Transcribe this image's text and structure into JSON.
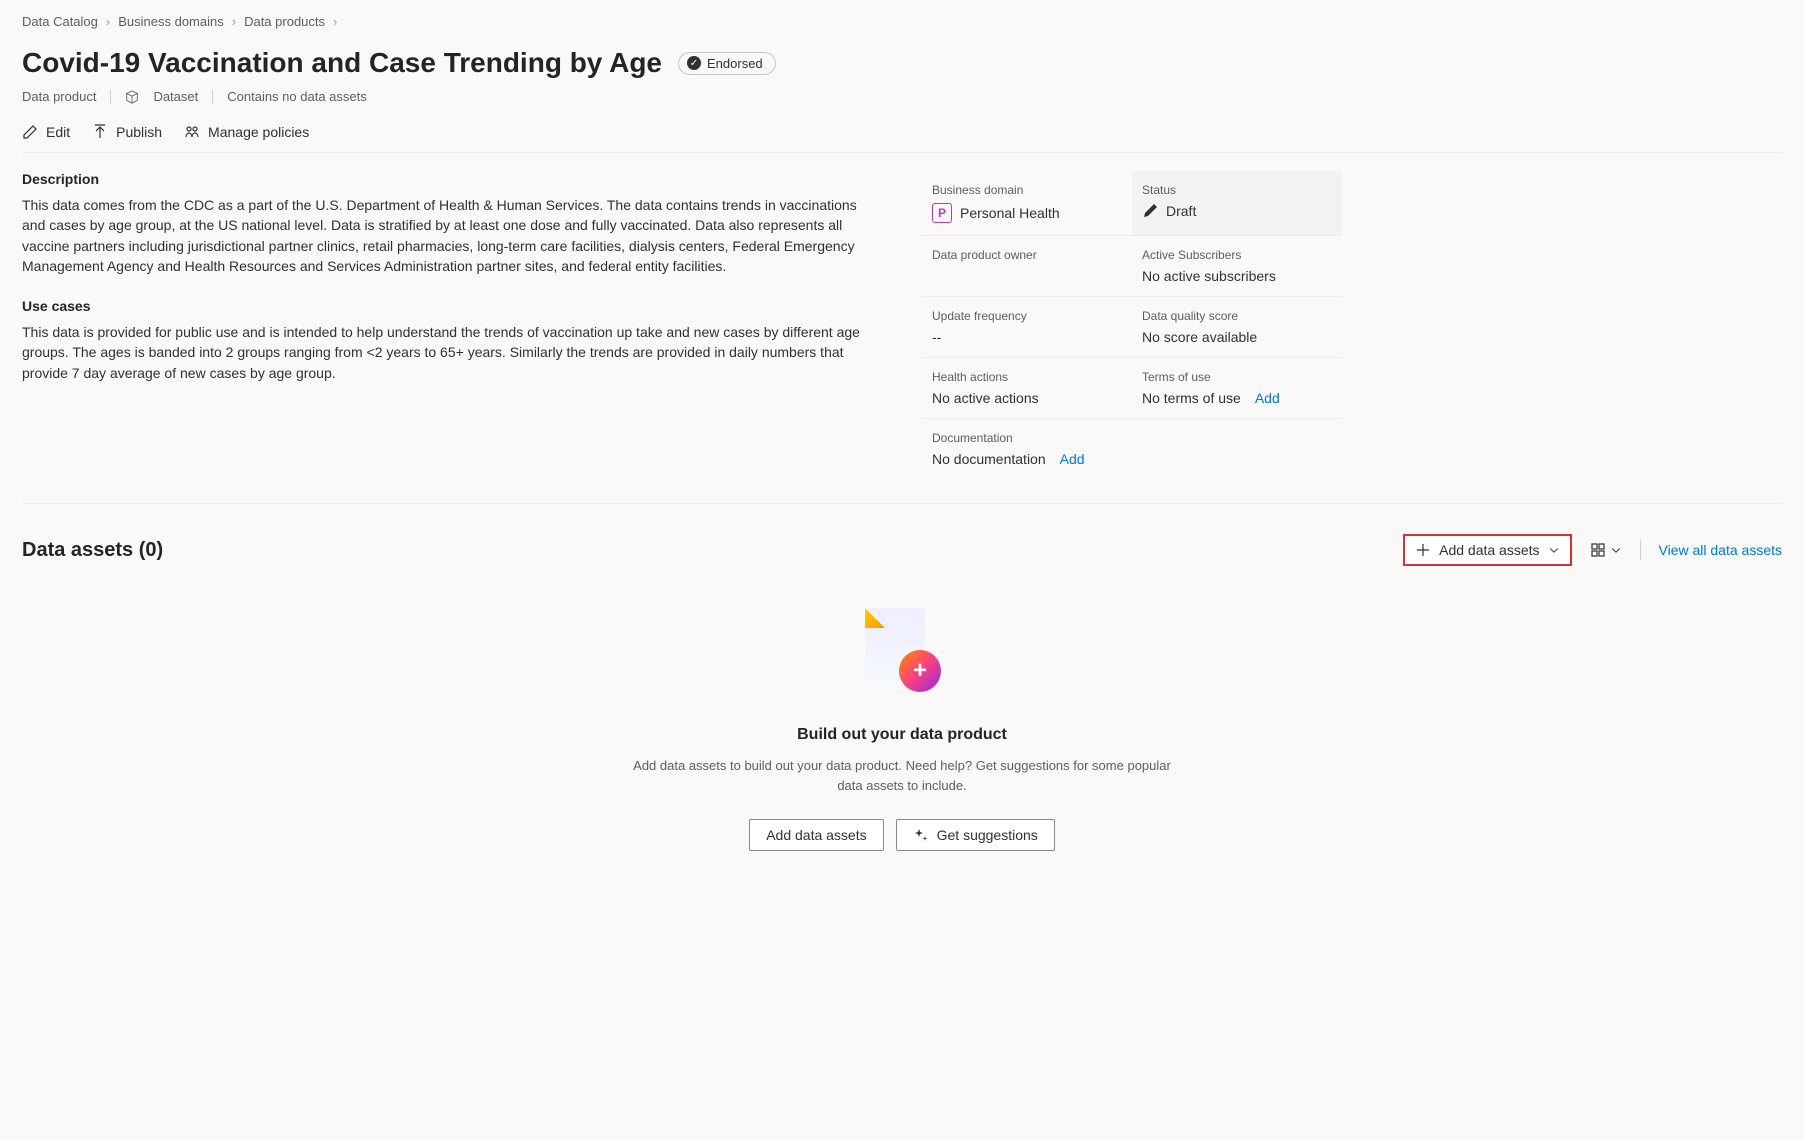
{
  "breadcrumb": {
    "items": [
      "Data Catalog",
      "Business domains",
      "Data products"
    ]
  },
  "header": {
    "title": "Covid-19 Vaccination and Case Trending by Age",
    "endorsed_label": "Endorsed",
    "type_label": "Data product",
    "dataset_label": "Dataset",
    "assets_note": "Contains no data assets"
  },
  "toolbar": {
    "edit": "Edit",
    "publish": "Publish",
    "manage_policies": "Manage policies"
  },
  "description": {
    "heading": "Description",
    "text": "This data comes from the CDC as a part of the U.S. Department of Health & Human Services.  The data contains trends in vaccinations and cases by age group, at the US national level. Data is stratified by at least one dose and fully vaccinated. Data also represents all vaccine partners including jurisdictional partner clinics, retail pharmacies, long-term care facilities, dialysis centers, Federal Emergency Management Agency and Health Resources and Services Administration partner sites, and federal entity facilities."
  },
  "use_cases": {
    "heading": "Use cases",
    "text": "This data is provided for public use and is intended to help understand the trends of vaccination up take and new cases by different age groups.  The ages is banded into 2 groups ranging from <2 years to 65+ years.  Similarly the trends are provided in daily numbers that provide 7 day average of new cases by age group."
  },
  "meta": {
    "business_domain": {
      "label": "Business domain",
      "badge_letter": "P",
      "value": "Personal Health"
    },
    "status": {
      "label": "Status",
      "value": "Draft"
    },
    "owner": {
      "label": "Data product owner",
      "value": ""
    },
    "subscribers": {
      "label": "Active Subscribers",
      "value": "No active subscribers"
    },
    "update_freq": {
      "label": "Update frequency",
      "value": "--"
    },
    "quality": {
      "label": "Data quality score",
      "value": "No score available"
    },
    "health": {
      "label": "Health actions",
      "value": "No active actions"
    },
    "terms": {
      "label": "Terms of use",
      "value": "No terms of use",
      "action": "Add"
    },
    "docs": {
      "label": "Documentation",
      "value": "No documentation",
      "action": "Add"
    }
  },
  "data_assets": {
    "heading": "Data assets (0)",
    "add_button": "Add data assets",
    "view_all": "View all data assets",
    "empty": {
      "title": "Build out your data product",
      "text": "Add data assets to build out your data product. Need help? Get suggestions for some popular data assets to include.",
      "btn_add": "Add data assets",
      "btn_suggest": "Get suggestions"
    }
  }
}
